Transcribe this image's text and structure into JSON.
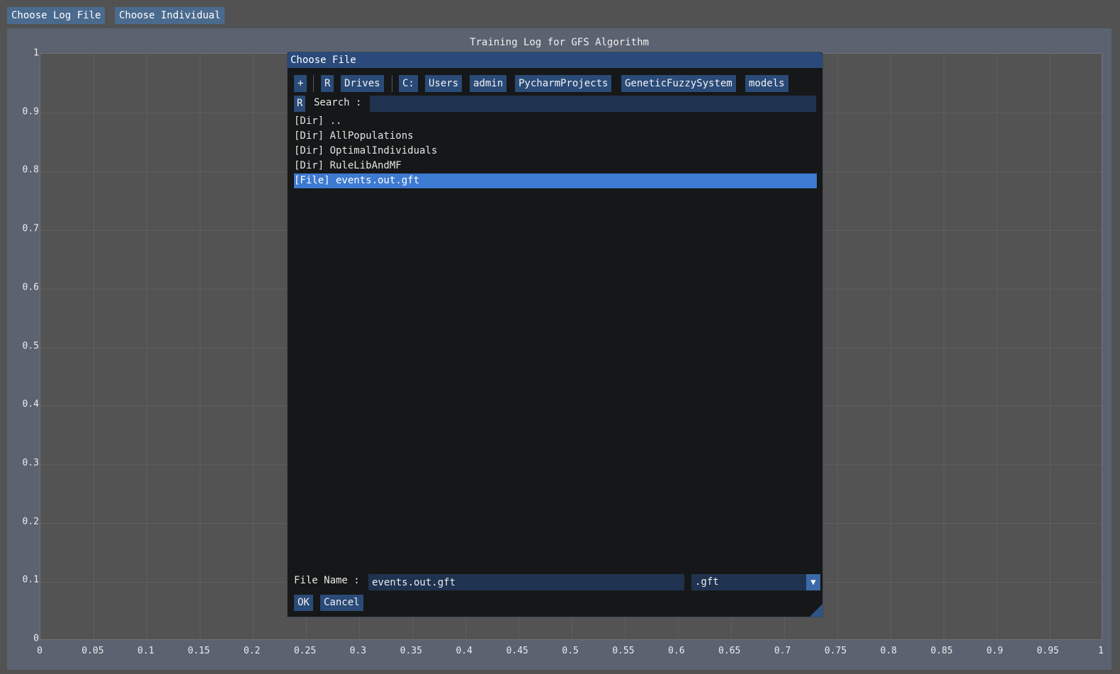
{
  "top_bar": {
    "choose_log_file": "Choose Log File",
    "choose_individual": "Choose Individual"
  },
  "plot": {
    "title": "Training Log for GFS Algorithm"
  },
  "chart_data": {
    "type": "line",
    "title": "Training Log for GFS Algorithm",
    "xlabel": "",
    "ylabel": "",
    "xlim": [
      0,
      1
    ],
    "ylim": [
      0,
      1
    ],
    "x_ticks": [
      "0",
      "0.05",
      "0.1",
      "0.15",
      "0.2",
      "0.25",
      "0.3",
      "0.35",
      "0.4",
      "0.45",
      "0.5",
      "0.55",
      "0.6",
      "0.65",
      "0.7",
      "0.75",
      "0.8",
      "0.85",
      "0.9",
      "0.95",
      "1"
    ],
    "y_ticks": [
      "0",
      "0.1",
      "0.2",
      "0.3",
      "0.4",
      "0.5",
      "0.6",
      "0.7",
      "0.8",
      "0.9",
      "1"
    ],
    "grid": true,
    "series": []
  },
  "dialog": {
    "title": "Choose File",
    "path_toolbar": {
      "add": "+",
      "reset": "R",
      "drives": "Drives",
      "segments": [
        "C:",
        "Users",
        "admin",
        "PycharmProjects",
        "GeneticFuzzySystem",
        "models"
      ]
    },
    "search": {
      "reset": "R",
      "label": "Search :",
      "value": ""
    },
    "entries": [
      {
        "label": "[Dir] .."
      },
      {
        "label": "[Dir] AllPopulations"
      },
      {
        "label": "[Dir] OptimalIndividuals"
      },
      {
        "label": "[Dir] RuleLibAndMF"
      },
      {
        "label": "[File] events.out.gft"
      }
    ],
    "selected_index": 4,
    "file_name": {
      "label": "File Name :",
      "value": "events.out.gft"
    },
    "filter": {
      "selected": ".gft",
      "arrow": "▼"
    },
    "ok": "OK",
    "cancel": "Cancel"
  },
  "colors": {
    "background": "#525252",
    "button": "#4a6a8e",
    "dialog_title": "#294a7a",
    "dialog_bg": "#161718",
    "selection": "#3d7ad1",
    "input_bg": "#1f3350"
  }
}
